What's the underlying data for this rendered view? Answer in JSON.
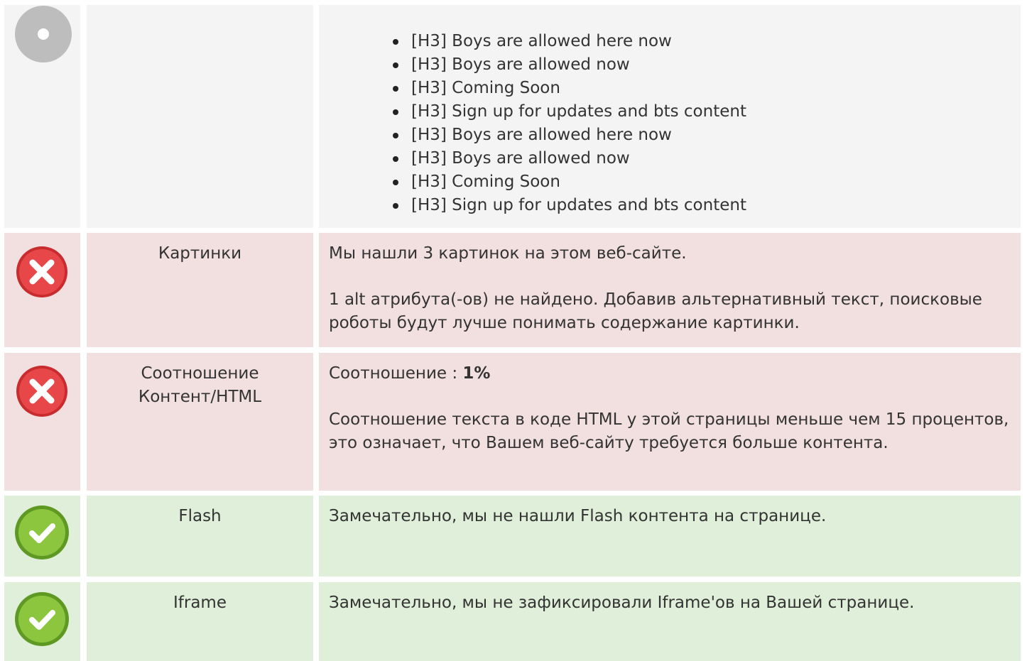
{
  "rows": [
    {
      "status": "neutral",
      "icon": "info-circle-icon",
      "label": "",
      "h3_items": [
        "[H3] Boys are allowed here now",
        "[H3] Boys are allowed now",
        "[H3] Coming Soon",
        "[H3] Sign up for updates and bts content",
        "[H3] Boys are allowed here now",
        "[H3] Boys are allowed now",
        "[H3] Coming Soon",
        "[H3] Sign up for updates and bts content"
      ]
    },
    {
      "status": "error",
      "icon": "error-x-icon",
      "label": "Картинки",
      "line1": "Мы нашли 3 картинок на этом веб-сайте.",
      "line2": "1 alt атрибута(-ов) не найдено. Добавив альтернативный текст, поисковые роботы будут лучше понимать содержание картинки."
    },
    {
      "status": "error",
      "icon": "error-x-icon",
      "label": "Соотношение Контент/HTML",
      "ratio_prefix": "Соотношение : ",
      "ratio_value": "1%",
      "line2": "Соотношение текста в коде HTML у этой страницы меньше чем 15 процентов, это означает, что Вашем веб-сайту требуется больше контента."
    },
    {
      "status": "ok",
      "icon": "check-icon",
      "label": "Flash",
      "line1": "Замечательно, мы не нашли Flash контента на странице."
    },
    {
      "status": "ok",
      "icon": "check-icon",
      "label": "Iframe",
      "line1": "Замечательно, мы не зафиксировали Iframe'ов на Вашей странице."
    }
  ],
  "colors": {
    "neutral_bg": "#f4f4f4",
    "error_bg": "#f2dfe0",
    "ok_bg": "#dfefd9",
    "error_icon": "#d9383a",
    "ok_icon": "#7cb83a",
    "neutral_icon": "#bdbdbd"
  }
}
